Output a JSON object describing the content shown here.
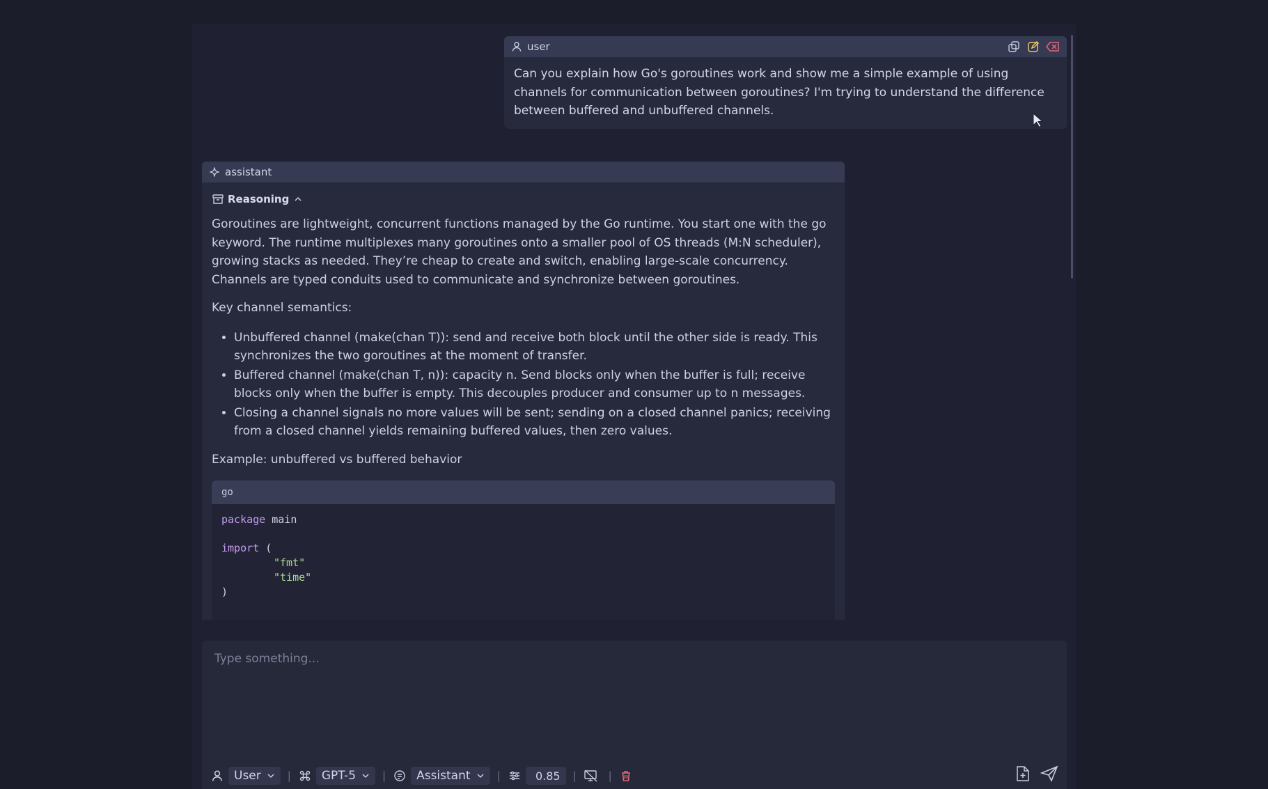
{
  "user_message": {
    "role": "user",
    "text": "Can you explain how Go's goroutines work and show me a simple example of using channels for communication between goroutines? I'm trying to understand the difference between buffered and unbuffered channels.",
    "actions": [
      "copy-icon",
      "edit-icon",
      "delete-icon"
    ]
  },
  "assistant_message": {
    "role": "assistant",
    "reasoning_label": "Reasoning",
    "intro": "Goroutines are lightweight, concurrent functions managed by the Go runtime. You start one with the go keyword. The runtime multiplexes many goroutines onto a smaller pool of OS threads (M:N scheduler), growing stacks as needed. They’re cheap to create and switch, enabling large-scale concurrency. Channels are typed conduits used to communicate and synchronize between goroutines.",
    "key_heading": "Key channel semantics:",
    "bullets": [
      "Unbuffered channel (make(chan T)): send and receive both block until the other side is ready. This synchronizes the two goroutines at the moment of transfer.",
      "Buffered channel (make(chan T, n)): capacity n. Send blocks only when the buffer is full; receive blocks only when the buffer is empty. This decouples producer and consumer up to n messages.",
      "Closing a channel signals no more values will be sent; sending on a closed channel panics; receiving from a closed channel yields remaining buffered values, then zero values."
    ],
    "example_heading": "Example: unbuffered vs buffered behavior",
    "code": {
      "language": "go",
      "kw_package": "package",
      "pkg_name": "main",
      "kw_import": "import",
      "open_paren": "(",
      "imports": [
        "\"fmt\"",
        "\"time\""
      ],
      "close_paren": ")"
    }
  },
  "composer": {
    "placeholder": "Type something...",
    "role_select": "User",
    "model_select": "GPT-5",
    "prompt_select": "Assistant",
    "temperature": "0.85"
  },
  "colors": {
    "background": "#1b1d2b",
    "panel": "#272a3d",
    "header": "#363a52",
    "accent_edit": "#e8c46a",
    "accent_delete": "#e06b7a",
    "keyword": "#c59cf0",
    "string": "#a9d98f"
  }
}
